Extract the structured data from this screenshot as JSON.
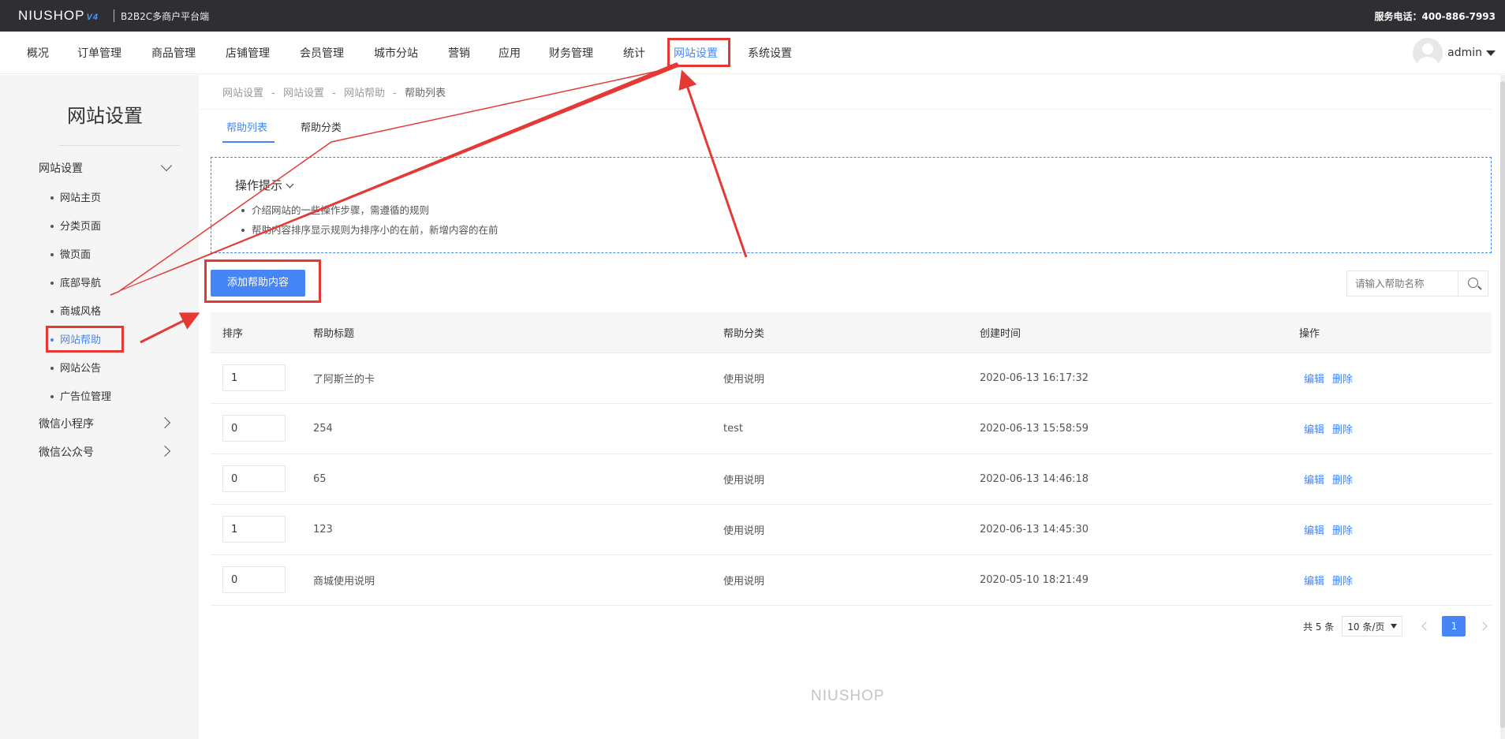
{
  "topbar": {
    "logo": "NIUSHOP",
    "logo_version": "V4",
    "subtitle": "B2B2C多商户平台端",
    "service": "服务电话：400-886-7993"
  },
  "nav": {
    "items": [
      "概况",
      "订单管理",
      "商品管理",
      "店铺管理",
      "会员管理",
      "城市分站",
      "营销",
      "应用",
      "财务管理",
      "统计",
      "网站设置",
      "系统设置"
    ],
    "active": "网站设置",
    "user": "admin"
  },
  "sidebar": {
    "title": "网站设置",
    "group1": "网站设置",
    "items": [
      "网站主页",
      "分类页面",
      "微页面",
      "底部导航",
      "商城风格",
      "网站帮助",
      "网站公告",
      "广告位管理"
    ],
    "active": "网站帮助",
    "group2": "微信小程序",
    "group3": "微信公众号"
  },
  "breadcrumb": {
    "items": [
      "网站设置",
      "网站设置",
      "网站帮助"
    ],
    "sep": "-",
    "current": "帮助列表"
  },
  "tabs": [
    "帮助列表",
    "帮助分类"
  ],
  "tips": {
    "title": "操作提示",
    "lines": [
      "介绍网站的一些操作步骤，需遵循的规则",
      "帮助内容排序显示规则为排序小的在前，新增内容的在前"
    ]
  },
  "toolbar": {
    "add_label": "添加帮助内容",
    "search_placeholder": "请输入帮助名称"
  },
  "table": {
    "headers": [
      "排序",
      "帮助标题",
      "帮助分类",
      "创建时间",
      "操作"
    ],
    "rows": [
      {
        "sort": "1",
        "title": "了阿斯兰的卡",
        "category": "使用说明",
        "created": "2020-06-13 16:17:32"
      },
      {
        "sort": "0",
        "title": "254",
        "category": "test",
        "created": "2020-06-13 15:58:59"
      },
      {
        "sort": "0",
        "title": "65",
        "category": "使用说明",
        "created": "2020-06-13 14:46:18"
      },
      {
        "sort": "1",
        "title": "123",
        "category": "使用说明",
        "created": "2020-06-13 14:45:30"
      },
      {
        "sort": "0",
        "title": "商城使用说明",
        "category": "使用说明",
        "created": "2020-05-10 18:21:49"
      }
    ],
    "op_edit": "编辑",
    "op_delete": "删除"
  },
  "pager": {
    "total": "共 5 条",
    "page_size": "10 条/页",
    "current": "1"
  },
  "footer": {
    "logo": "NIUSHOP"
  },
  "colors": {
    "accent": "#4685f5",
    "annotation": "#e53935",
    "topbar": "#2f2f33"
  }
}
